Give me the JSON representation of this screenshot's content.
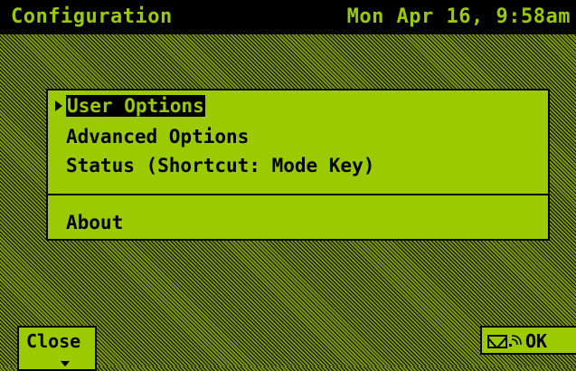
{
  "title_bar": {
    "title": "Configuration",
    "datetime": "Mon Apr 16, 9:58am"
  },
  "menu": {
    "items": [
      {
        "label": "User Options",
        "selected": true
      },
      {
        "label": "Advanced Options",
        "selected": false
      },
      {
        "label": "Status (Shortcut: Mode Key)",
        "selected": false
      }
    ],
    "about_label": "About"
  },
  "buttons": {
    "close_label": "Close",
    "ok_label": "OK"
  },
  "icons": {
    "selection_pointer": "triangle-right",
    "close_arrow": "triangle-down",
    "ok_icons": [
      "mail-icon",
      "signal-wave-icon"
    ]
  },
  "colors": {
    "screen_green": "#9bca00",
    "backdrop_green": "#7d9800",
    "ink": "#000000"
  }
}
